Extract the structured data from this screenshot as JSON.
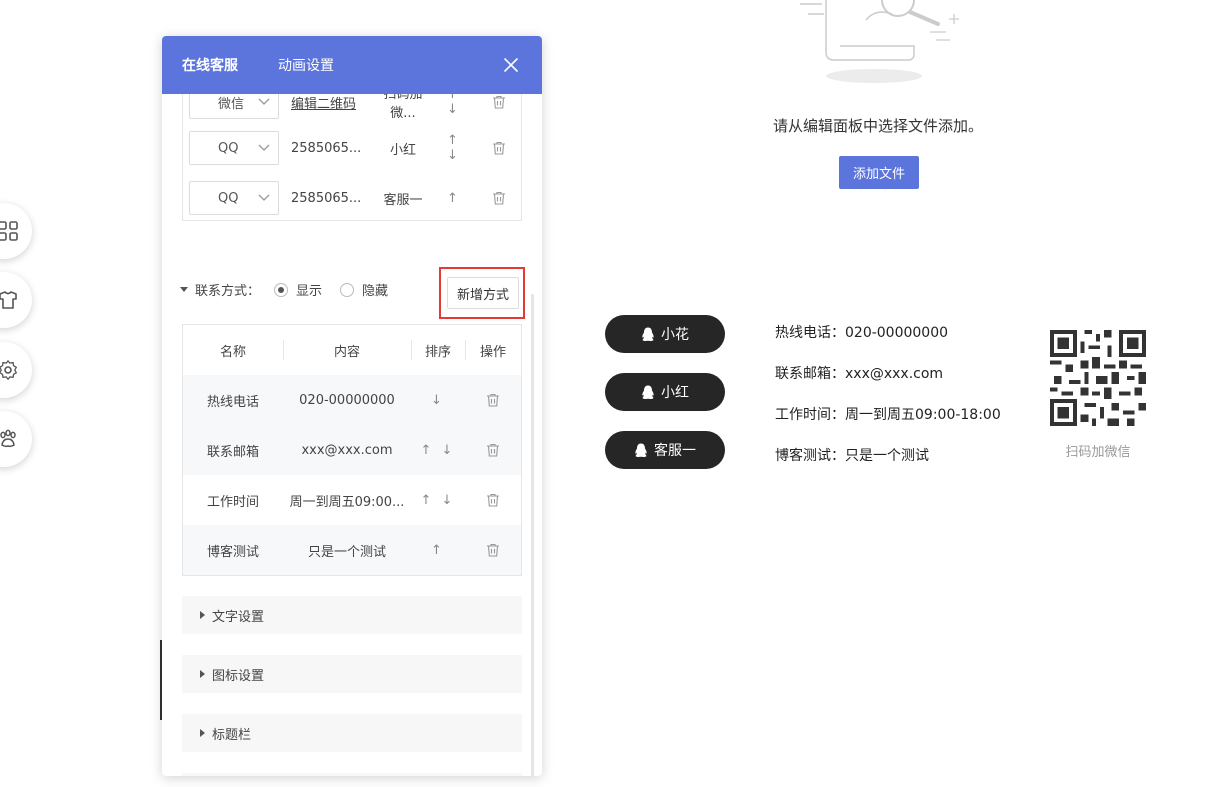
{
  "panel": {
    "tabs": [
      {
        "label": "在线客服",
        "active": true
      },
      {
        "label": "动画设置",
        "active": false
      }
    ]
  },
  "service_list": {
    "rows": [
      {
        "type": "微信",
        "account": "编辑二维码",
        "name": "扫码加微...",
        "sort": "↑ ↓"
      },
      {
        "type": "QQ",
        "account": "2585065...",
        "name": "小红",
        "sort": "↑ ↓"
      },
      {
        "type": "QQ",
        "account": "2585065...",
        "name": "客服一",
        "sort": "↑"
      }
    ]
  },
  "contact": {
    "label": "联系方式：",
    "show_label": "显示",
    "hide_label": "隐藏",
    "selected": "显示",
    "add_button": "新增方式",
    "headers": {
      "name": "名称",
      "content": "内容",
      "sort": "排序",
      "op": "操作"
    },
    "rows": [
      {
        "name": "热线电话",
        "content": "020-00000000",
        "sort": "↓"
      },
      {
        "name": "联系邮箱",
        "content": "xxx@xxx.com",
        "sort": "↑ ↓"
      },
      {
        "name": "工作时间",
        "content": "周一到周五09:00...",
        "sort": "↑ ↓"
      },
      {
        "name": "博客测试",
        "content": "只是一个测试",
        "sort": "↑"
      }
    ]
  },
  "sections": [
    "文字设置",
    "图标设置",
    "标题栏"
  ],
  "preview": {
    "empty_text": "请从编辑面板中选择文件添加。",
    "add_file": "添加文件",
    "pills": [
      "小花",
      "小红",
      "客服一"
    ],
    "info": [
      "热线电话：020-00000000",
      "联系邮箱：xxx@xxx.com",
      "工作时间：周一到周五09:00-18:00",
      "博客测试：只是一个测试"
    ],
    "qr_caption": "扫码加微信"
  },
  "colors": {
    "accent": "#5b75dd",
    "pill": "#262626",
    "highlight": "#e53935"
  }
}
